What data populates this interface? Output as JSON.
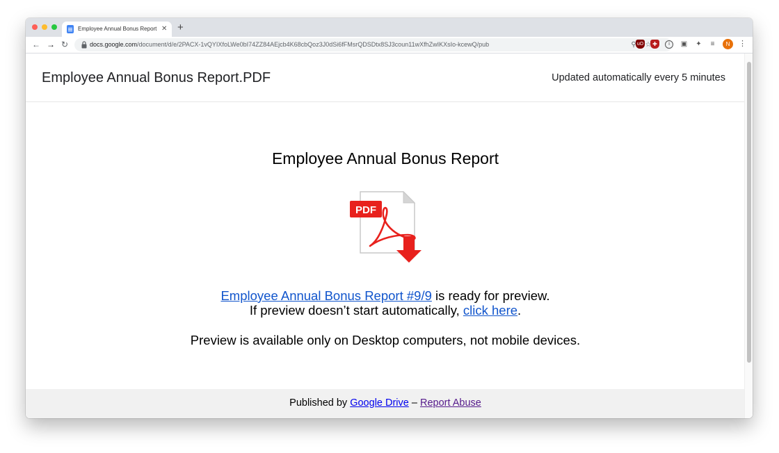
{
  "browser": {
    "tab_title": "Employee Annual Bonus Report",
    "new_tab_label": "+",
    "url_domain": "docs.google.com",
    "url_path": "/document/d/e/2PACX-1vQYIXfoLWe0bI74ZZ84AEjcb4K68cbQoz3J0dSi6fFMsrQDSDtx8SJ3coun11wXfhZwIKXsIo-kcewQ/pub",
    "avatar_initial": "N",
    "icons": {
      "back": "arrow-left-icon",
      "forward": "arrow-right-icon",
      "reload": "reload-icon",
      "lock": "lock-icon",
      "zoom": "zoom-icon",
      "bookmark": "star-icon",
      "menu": "more-vert-icon"
    }
  },
  "doc": {
    "title": "Employee Annual Bonus Report.PDF",
    "updated_text": "Updated automatically every 5 minutes"
  },
  "content": {
    "heading": "Employee Annual Bonus Report",
    "pdf_badge": "PDF",
    "report_link": "Employee Annual Bonus Report #9/9",
    "ready_text": " is ready for preview.",
    "auto_text": "If preview doesn’t start automatically, ",
    "click_here": "click here",
    "period": ".",
    "desktop_note": "Preview is available only on Desktop computers, not mobile devices."
  },
  "footer": {
    "published_by": "Published by ",
    "drive_link": "Google Drive",
    "separator": " – ",
    "report_abuse": "Report Abuse"
  },
  "colors": {
    "pdf_red": "#e8211d",
    "link_blue": "#1155cc",
    "footer_bg": "#f1f1f1"
  }
}
